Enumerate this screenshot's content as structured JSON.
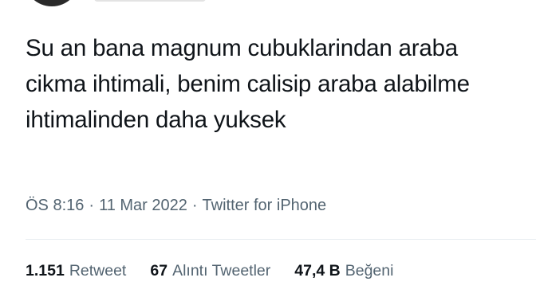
{
  "tweet": {
    "text": "Su an bana magnum cubuklarindan araba cikma ihtimali, benim calisip araba alabilme ihtimalinden daha yuksek",
    "time": "ÖS 8:16",
    "separator": "·",
    "date": "11 Mar 2022",
    "source": "Twitter for iPhone"
  },
  "stats": [
    {
      "count": "1.151",
      "label": "Retweet"
    },
    {
      "count": "67",
      "label": "Alıntı Tweetler"
    },
    {
      "count": "47,4 B",
      "label": "Beğeni"
    }
  ]
}
